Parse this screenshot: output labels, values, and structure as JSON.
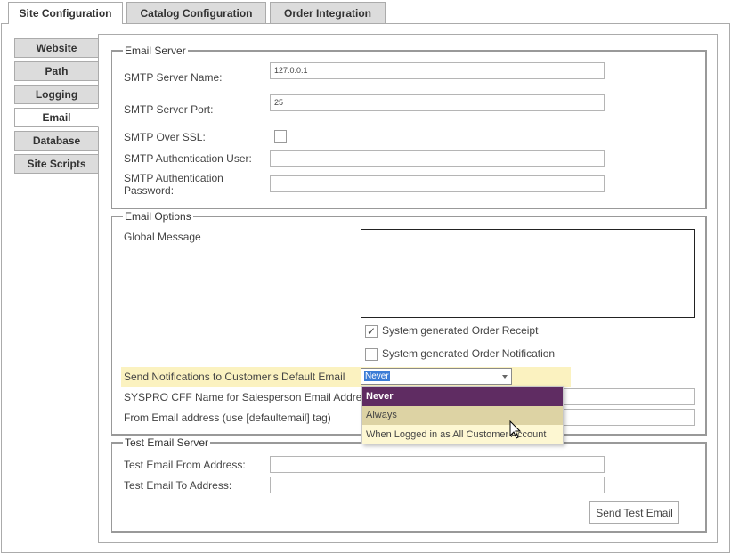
{
  "top_tabs": [
    {
      "label": "Site Configuration",
      "active": true
    },
    {
      "label": "Catalog Configuration",
      "active": false
    },
    {
      "label": "Order Integration",
      "active": false
    }
  ],
  "side_tabs": [
    {
      "label": "Website",
      "active": false
    },
    {
      "label": "Path",
      "active": false
    },
    {
      "label": "Logging",
      "active": false
    },
    {
      "label": "Email",
      "active": true
    },
    {
      "label": "Database",
      "active": false
    },
    {
      "label": "Site Scripts",
      "active": false
    }
  ],
  "email_server": {
    "legend": "Email Server",
    "smtp_server_name_label": "SMTP Server Name:",
    "smtp_server_name_value": "127.0.0.1",
    "smtp_server_port_label": "SMTP Server Port:",
    "smtp_server_port_value": "25",
    "smtp_over_ssl_label": "SMTP Over SSL:",
    "smtp_over_ssl_checked": false,
    "smtp_auth_user_label": "SMTP Authentication User:",
    "smtp_auth_user_value": "",
    "smtp_auth_password_label_line1": "SMTP Authentication",
    "smtp_auth_password_label_line2": "Password:",
    "smtp_auth_password_value": ""
  },
  "email_options": {
    "legend": "Email Options",
    "global_message_label": "Global Message",
    "global_message_value": "",
    "order_receipt_label": "System generated Order Receipt",
    "order_receipt_checked": true,
    "order_notification_label": "System generated Order Notification",
    "order_notification_checked": false,
    "send_notifications_label": "Send Notifications to Customer's Default Email",
    "send_notifications_selected": "Never",
    "send_notifications_options": [
      "Never",
      "Always",
      "When Logged in as All Customer Account"
    ],
    "syspro_cff_label": "SYSPRO CFF Name for Salesperson Email Address",
    "syspro_cff_value": "",
    "from_email_label": "From Email address (use [defaultemail] tag)",
    "from_email_value": ""
  },
  "test_email_server": {
    "legend": "Test Email Server",
    "from_address_label": "Test Email From Address:",
    "from_address_value": "",
    "to_address_label": "Test Email To Address:",
    "to_address_value": "",
    "send_button_label": "Send Test Email"
  },
  "colors": {
    "dropdown_selected": "#5f2c62",
    "dropdown_hover": "#ddd3a4",
    "dropdown_bg": "#fdf7d2",
    "row_highlight": "#fbf2c0",
    "selection_blue": "#3b7cd6"
  }
}
